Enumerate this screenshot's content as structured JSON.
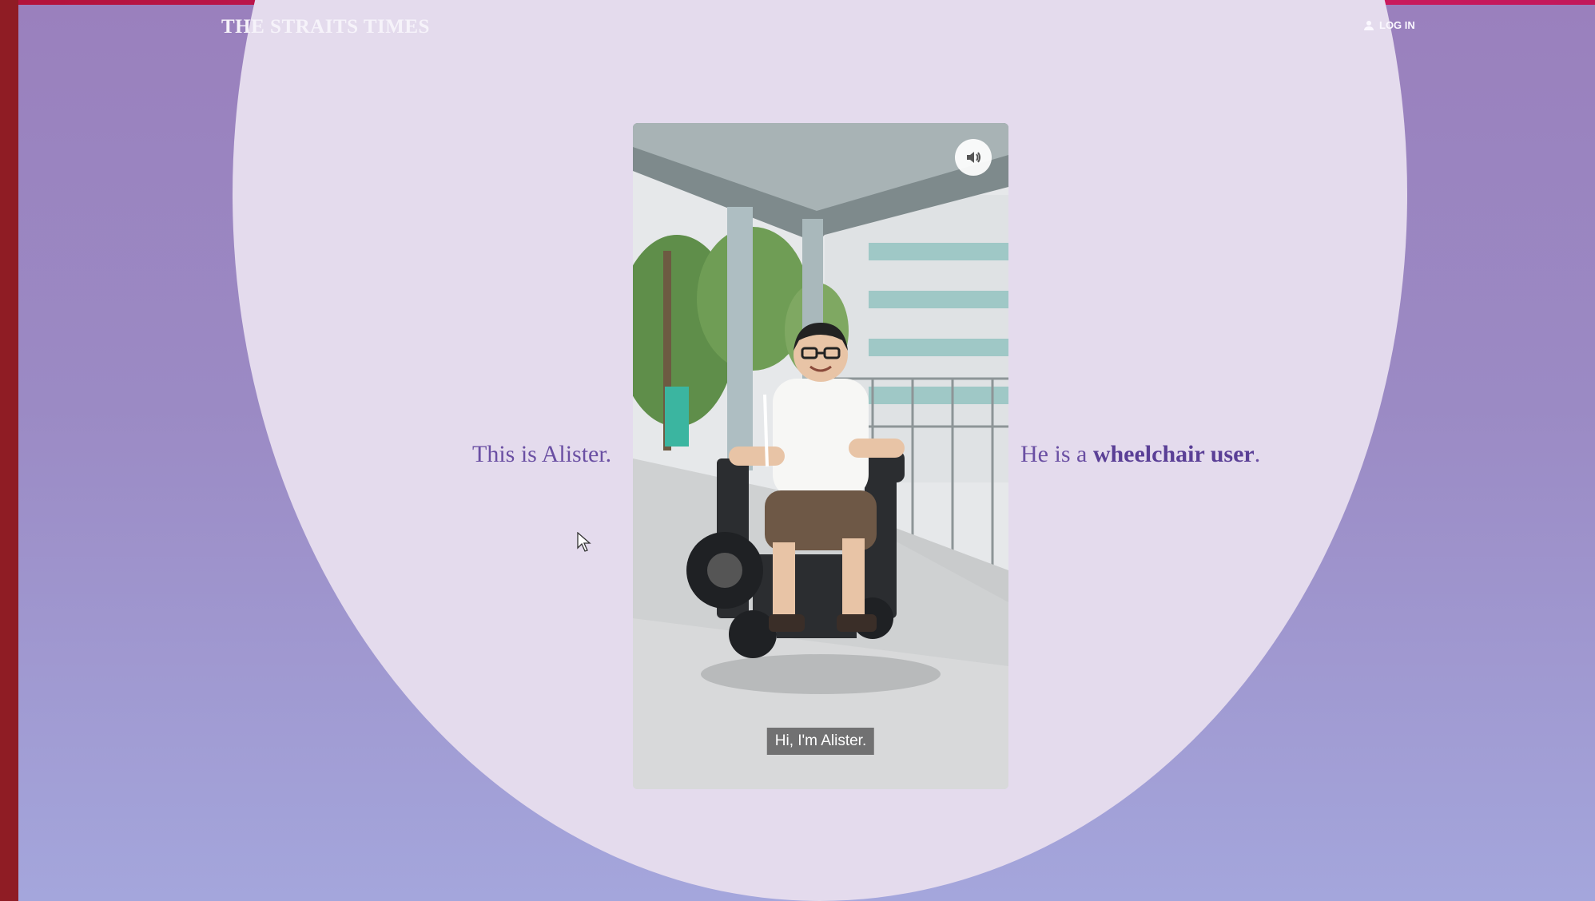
{
  "header": {
    "logo": "THE STRAITS TIMES",
    "login_label": "LOG IN",
    "login_icon": "user-icon"
  },
  "story": {
    "left_text": "This is Alister.",
    "right_prefix": "He is a ",
    "right_emphasis": "wheelchair user",
    "right_suffix": "."
  },
  "video": {
    "caption": "Hi, I'm Alister.",
    "sound_icon": "speaker-icon"
  },
  "colors": {
    "accent": "#6a4fa3",
    "circle": "#e4dbed",
    "background_top": "#9a80bd",
    "background_bottom": "#a4a6dc",
    "top_strip": "#c2185b"
  }
}
